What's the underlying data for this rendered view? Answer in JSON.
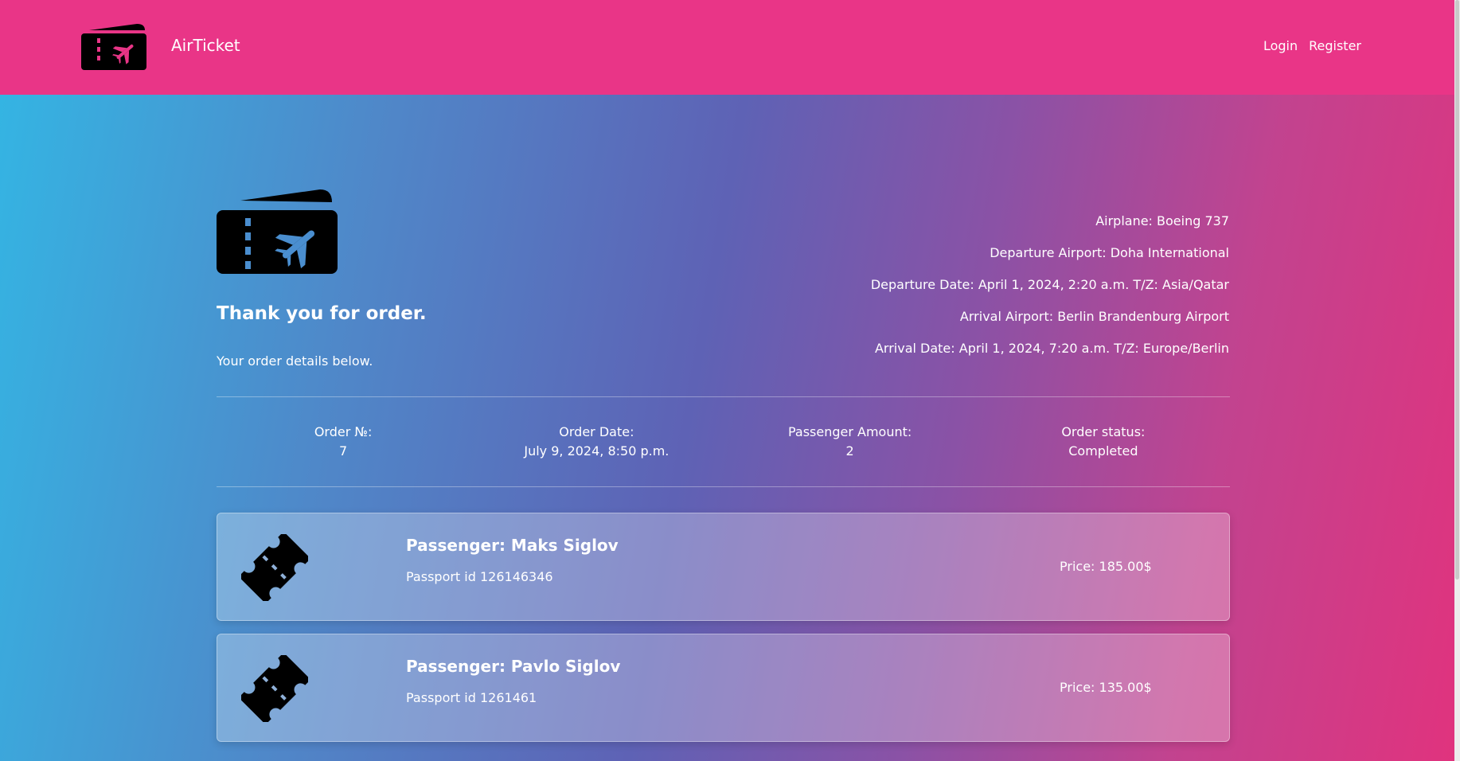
{
  "app": {
    "brand": "AirTicket"
  },
  "nav": {
    "login": "Login",
    "register": "Register"
  },
  "order": {
    "title": "Thank you for order.",
    "subtitle": "Your order details below.",
    "flight": {
      "airplane": "Airplane: Boeing 737",
      "departure_airport": "Departure Airport: Doha International",
      "departure_date": "Departure Date: April 1, 2024, 2:20 a.m. T/Z: Asia/Qatar",
      "arrival_airport": "Arrival Airport: Berlin Brandenburg Airport",
      "arrival_date": "Arrival Date: April 1, 2024, 7:20 a.m. T/Z: Europe/Berlin"
    },
    "meta": [
      {
        "label": "Order №:",
        "value": "7"
      },
      {
        "label": "Order Date:",
        "value": "July 9, 2024, 8:50 p.m."
      },
      {
        "label": "Passenger Amount:",
        "value": "2"
      },
      {
        "label": "Order status:",
        "value": "Completed"
      }
    ],
    "passengers": [
      {
        "name": "Passenger: Maks Siglov",
        "passport": "Passport id 126146346",
        "price": "Price: 185.00$"
      },
      {
        "name": "Passenger: Pavlo Siglov",
        "passport": "Passport id 1261461",
        "price": "Price: 135.00$"
      }
    ]
  },
  "colors": {
    "navbar": "#e93587",
    "logo_plane_nav": "#e93587",
    "logo_plane_hero": "#4a8ecf"
  },
  "icons": {
    "brand": "ticket-plane-icon",
    "passenger": "ticket-icon"
  }
}
